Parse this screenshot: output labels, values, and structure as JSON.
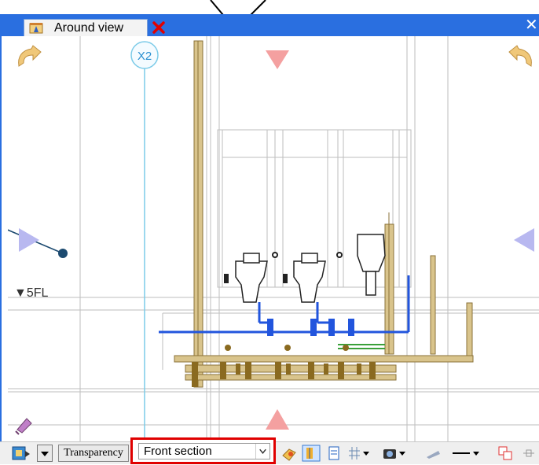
{
  "tab": {
    "title": "Around view"
  },
  "grid": {
    "axis_label": "X2"
  },
  "level": {
    "label": "▼5FL"
  },
  "toolbar": {
    "transparency_label": "Transparency",
    "section_select_value": "Front section"
  },
  "colors": {
    "tab_bar": "#2a6fe0",
    "highlight_border": "#e00000",
    "pipe_blue": "#2255dd",
    "pipe_tan": "#b8a06a",
    "grid_line": "#7ccbe8",
    "nav_arrow_purple": "#b8b8f0",
    "nav_arrow_pink": "#f4a0a0"
  },
  "icons": {
    "tab_icon": "view-window-icon",
    "tab_close": "close-icon",
    "window_close": "close-icon",
    "rotate_left": "rotate-left-icon",
    "rotate_right": "rotate-right-icon",
    "nav_up": "nav-down-arrow-icon",
    "nav_down": "nav-up-arrow-icon",
    "nav_left": "nav-right-arrow-icon",
    "nav_right": "nav-left-arrow-icon",
    "eyedropper": "eyedropper-icon"
  }
}
